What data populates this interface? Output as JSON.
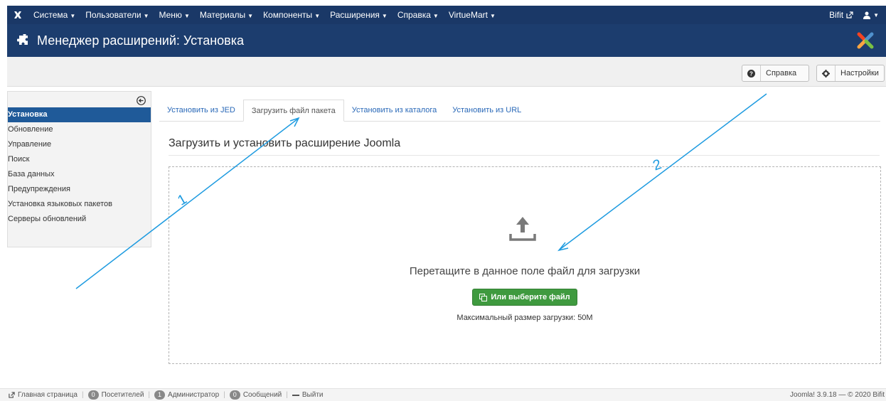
{
  "topnav": {
    "menu": [
      {
        "label": "Система"
      },
      {
        "label": "Пользователи"
      },
      {
        "label": "Меню"
      },
      {
        "label": "Материалы"
      },
      {
        "label": "Компоненты"
      },
      {
        "label": "Расширения"
      },
      {
        "label": "Справка"
      },
      {
        "label": "VirtueMart"
      }
    ],
    "site_link": "Bifit"
  },
  "header": {
    "title": "Менеджер расширений: Установка"
  },
  "toolbar": {
    "help_label": "Справка",
    "options_label": "Настройки"
  },
  "sidebar": {
    "items": [
      {
        "label": "Установка",
        "active": true
      },
      {
        "label": "Обновление"
      },
      {
        "label": "Управление"
      },
      {
        "label": "Поиск"
      },
      {
        "label": "База данных"
      },
      {
        "label": "Предупреждения"
      },
      {
        "label": "Установка языковых пакетов"
      },
      {
        "label": "Серверы обновлений"
      }
    ]
  },
  "tabs": [
    {
      "label": "Установить из JED"
    },
    {
      "label": "Загрузить файл пакета",
      "active": true
    },
    {
      "label": "Установить из каталога"
    },
    {
      "label": "Установить из URL"
    }
  ],
  "main": {
    "section_title": "Загрузить и установить расширение Joomla",
    "drop_text": "Перетащите в данное поле файл для загрузки",
    "pick_button": "Или выберите файл",
    "max_size": "Максимальный размер загрузки: 50M"
  },
  "annotations": {
    "label_1": "1",
    "label_2": "2",
    "color": "#1e9be0"
  },
  "footer": {
    "home": "Главная страница",
    "visitors_count": "0",
    "visitors": "Посетителей",
    "admins_count": "1",
    "admins": "Администратор",
    "messages_count": "0",
    "messages": "Сообщений",
    "logout": "Выйти",
    "version": "Joomla! 3.9.18 — © 2020 Bifit"
  },
  "colors": {
    "nav_bg": "#1a3867",
    "header_bg": "#1c3d6e",
    "active_sidebar": "#1f5a99",
    "green_button": "#3f9a3f"
  }
}
